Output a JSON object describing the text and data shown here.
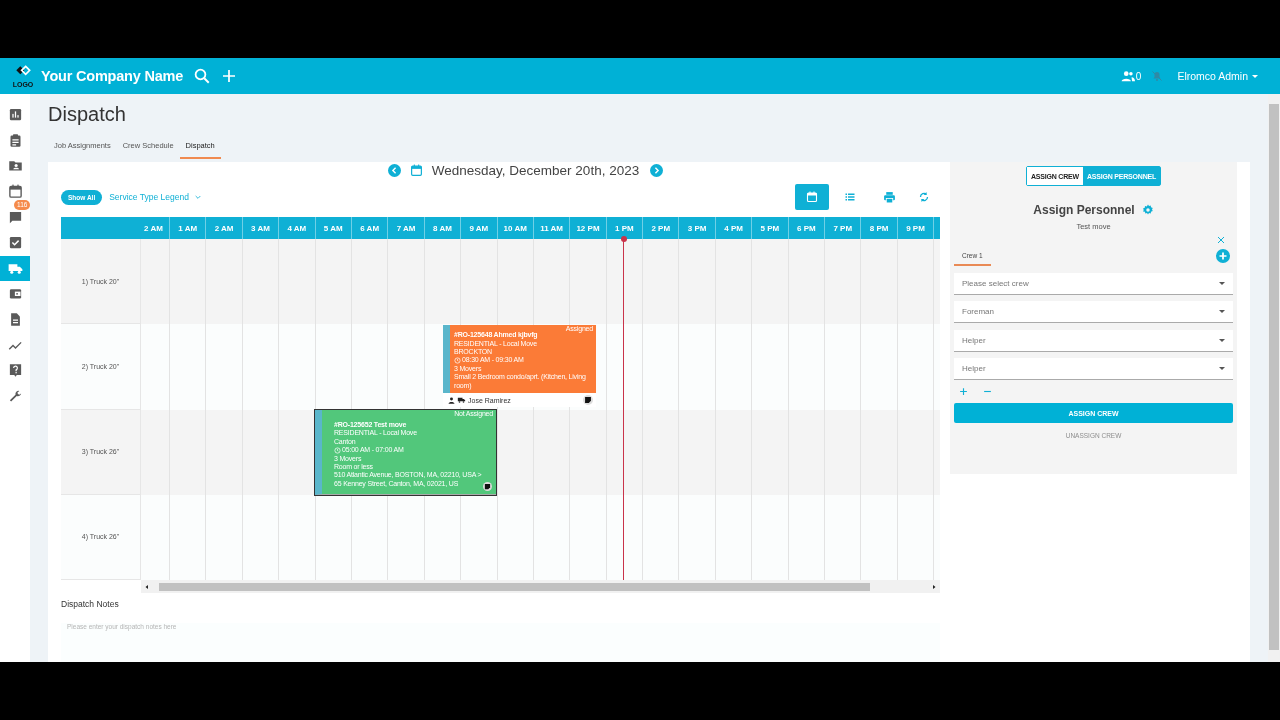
{
  "header": {
    "logo_text": "LOGO",
    "company": "Your Company Name",
    "team_count": "0",
    "user": "Elromco Admin"
  },
  "sidebar": {
    "items": [
      {
        "kind": "chart",
        "selected": false
      },
      {
        "kind": "clipboard",
        "selected": false
      },
      {
        "kind": "contacts",
        "selected": false
      },
      {
        "kind": "calendar",
        "selected": false
      },
      {
        "kind": "chat",
        "selected": false,
        "badge": "116"
      },
      {
        "kind": "check",
        "selected": false
      },
      {
        "kind": "truck",
        "selected": true
      },
      {
        "kind": "wallet",
        "selected": false
      },
      {
        "kind": "document",
        "selected": false
      },
      {
        "kind": "trend",
        "selected": false
      },
      {
        "kind": "help",
        "selected": false
      },
      {
        "kind": "wrench",
        "selected": false
      }
    ]
  },
  "page_title": "Dispatch",
  "tabs": [
    {
      "label": "Job Assignments",
      "selected": false
    },
    {
      "label": "Crew Schedule",
      "selected": false
    },
    {
      "label": "Dispatch",
      "selected": true
    }
  ],
  "date": "Wednesday, December 20th, 2023",
  "filter": {
    "show_all": "Show All",
    "legend": "Service Type Legend"
  },
  "views": [
    {
      "kind": "calendar",
      "selected": true
    },
    {
      "kind": "list",
      "selected": false
    }
  ],
  "timeline": {
    "hours": [
      "2 AM",
      "1 AM",
      "2 AM",
      "3 AM",
      "4 AM",
      "5 AM",
      "6 AM",
      "7 AM",
      "8 AM",
      "9 AM",
      "10 AM",
      "11 AM",
      "12 PM",
      "1 PM",
      "2 PM",
      "3 PM",
      "4 PM",
      "5 PM",
      "6 PM",
      "7 PM",
      "8 PM",
      "9 PM"
    ],
    "trucks": [
      {
        "name": "1) Truck 20\""
      },
      {
        "name": "2) Truck 20\"",
        "jobs": [
          {
            "status": "Assigned",
            "color": "#fb7b37",
            "title": "#RO-125648 Ahmed kjbvfg",
            "service": "RESIDENTIAL - Local Move",
            "city": "BROCKTON",
            "time": "08:30 AM - 09:30 AM",
            "movers": "3 Movers",
            "size": "Small 2 Bedroom condo/aprt. (Kitchen, Living room)",
            "crew": "Jose Ramirez"
          }
        ]
      },
      {
        "name": "3) Truck 26\"",
        "jobs": [
          {
            "status": "Not Assigned",
            "color": "#52c77b",
            "title": "#RO-125652 Test move",
            "service": "RESIDENTIAL - Local Move",
            "city": "Canton",
            "time": "05:00 AM - 07:00 AM",
            "movers": "3 Movers",
            "size": "Room or less",
            "address": "510 Atlantic Avenue, BOSTON, MA, 02210, USA > 65 Kenney Street, Canton, MA, 02021, US"
          }
        ]
      },
      {
        "name": "4) Truck 26\""
      }
    ]
  },
  "notes": {
    "label": "Dispatch Notes",
    "placeholder": "Please enter your dispatch notes here"
  },
  "panel": {
    "modes": [
      {
        "label": "ASSIGN CREW",
        "selected": false
      },
      {
        "label": "ASSIGN PERSONNEL",
        "selected": true
      }
    ],
    "title": "Assign Personnel",
    "subtitle": "Test move",
    "crews": [
      {
        "label": "Crew 1",
        "selected": true
      }
    ],
    "selects": [
      {
        "placeholder": "Please select crew"
      },
      {
        "placeholder": "Foreman"
      },
      {
        "placeholder": "Helper"
      },
      {
        "placeholder": "Helper"
      }
    ],
    "assign": "ASSIGN CREW",
    "unassign": {
      "label": "UNASSIGN CREW",
      "disabled": true
    }
  }
}
